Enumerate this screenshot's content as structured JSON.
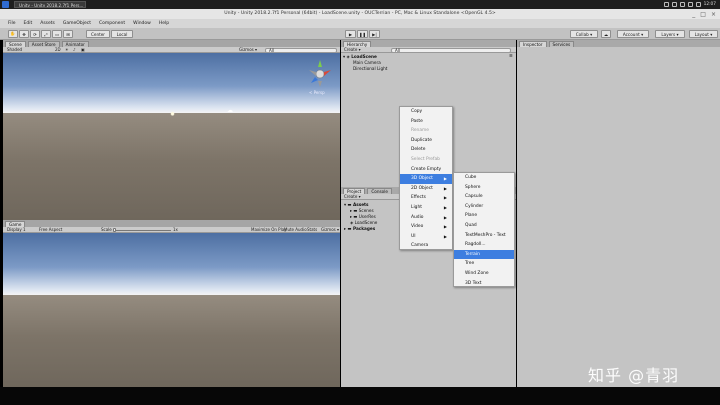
{
  "taskbar": {
    "app_label": "Unity - Unity 2018.2.7f1 Pers...",
    "time": "12:07"
  },
  "window": {
    "title": "Unity - Unity 2018.2.7f1 Personal (64bit) - LoadScene.unity - OUCTerrian - PC, Mac & Linux Standalone <OpenGL 4.5>",
    "controls": [
      "_",
      "□",
      "×"
    ]
  },
  "menubar": [
    "File",
    "Edit",
    "Assets",
    "GameObject",
    "Component",
    "Window",
    "Help"
  ],
  "toolbar": {
    "center_label": "Center",
    "local_label": "Local",
    "collab_label": "Collab ▾",
    "account_label": "Account ▾",
    "layers_label": "Layers ▾",
    "layout_label": "Layout ▾"
  },
  "scene_panel": {
    "tabs": [
      "Scene",
      "Asset Store",
      "Animator"
    ],
    "shading_mode": "Shaded",
    "mode_2d": "2D",
    "gizmos_label": "Gizmos ▾",
    "search_placeholder": "All",
    "persp_label": "< Persp"
  },
  "game_panel": {
    "tab": "Game",
    "display": "Display 1",
    "aspect": "Free Aspect",
    "scale_label": "Scale",
    "scale_value": "1x",
    "options": [
      "Maximize On Play",
      "Mute Audio",
      "Stats",
      "Gizmos ▾"
    ]
  },
  "hierarchy": {
    "tab": "Hierarchy",
    "create_label": "Create ▾",
    "search_placeholder": "All",
    "scene_name": "LoadScene",
    "items": [
      "Main Camera",
      "Directional Light"
    ]
  },
  "project": {
    "tabs": [
      "Project",
      "Console"
    ],
    "create_label": "Create ▾",
    "tree": [
      "Assets",
      "Scenes",
      "UserRes",
      "LoadScene",
      "Packages"
    ]
  },
  "inspector": {
    "tabs": [
      "Inspector",
      "Services"
    ]
  },
  "context_menu": {
    "items": [
      {
        "label": "Copy",
        "disabled": false,
        "submenu": false
      },
      {
        "label": "Paste",
        "disabled": false,
        "submenu": false
      },
      {
        "label": "Rename",
        "disabled": true,
        "submenu": false
      },
      {
        "label": "Duplicate",
        "disabled": false,
        "submenu": false
      },
      {
        "label": "Delete",
        "disabled": false,
        "submenu": false
      },
      {
        "label": "Select Prefab",
        "disabled": true,
        "submenu": false
      },
      {
        "label": "Create Empty",
        "disabled": false,
        "submenu": false
      },
      {
        "label": "3D Object",
        "disabled": false,
        "submenu": true,
        "highlight": true
      },
      {
        "label": "2D Object",
        "disabled": false,
        "submenu": true
      },
      {
        "label": "Effects",
        "disabled": false,
        "submenu": true
      },
      {
        "label": "Light",
        "disabled": false,
        "submenu": true
      },
      {
        "label": "Audio",
        "disabled": false,
        "submenu": true
      },
      {
        "label": "Video",
        "disabled": false,
        "submenu": true
      },
      {
        "label": "UI",
        "disabled": false,
        "submenu": true
      },
      {
        "label": "Camera",
        "disabled": false,
        "submenu": false
      }
    ]
  },
  "submenu_3d": {
    "items": [
      {
        "label": "Cube"
      },
      {
        "label": "Sphere"
      },
      {
        "label": "Capsule"
      },
      {
        "label": "Cylinder"
      },
      {
        "label": "Plane"
      },
      {
        "label": "Quad"
      },
      {
        "label": "TextMeshPro - Text"
      },
      {
        "label": "Ragdoll..."
      },
      {
        "label": "Terrain",
        "highlight": true
      },
      {
        "label": "Tree"
      },
      {
        "label": "Wind Zone"
      },
      {
        "label": "3D Text"
      }
    ]
  },
  "watermark": "知乎 @青羽",
  "colors": {
    "menu_highlight": "#3d7ee0",
    "panel_gray": "#c4c4c4",
    "toolbar_gray": "#c2c2c2"
  }
}
